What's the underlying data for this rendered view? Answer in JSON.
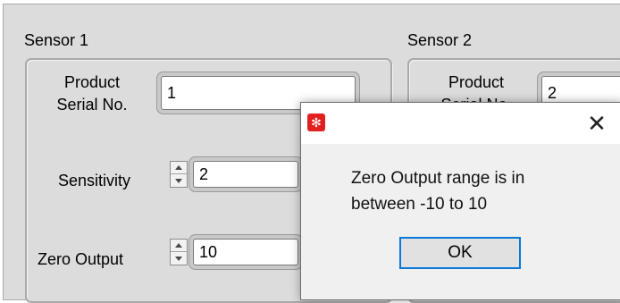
{
  "sensor1": {
    "group_label": "Sensor 1",
    "serial_label": "Product\nSerial No.",
    "serial_value": "1",
    "sensitivity_label": "Sensitivity",
    "sensitivity_value": "2",
    "zero_output_label": "Zero Output",
    "zero_output_value": "10"
  },
  "sensor2": {
    "group_label": "Sensor 2",
    "serial_label": "Product\nSerial No.",
    "serial_value": "2"
  },
  "dialog": {
    "icon": "app-icon",
    "close_glyph": "✕",
    "message": "Zero Output range is in between -10 to 10",
    "ok_label": "OK"
  }
}
